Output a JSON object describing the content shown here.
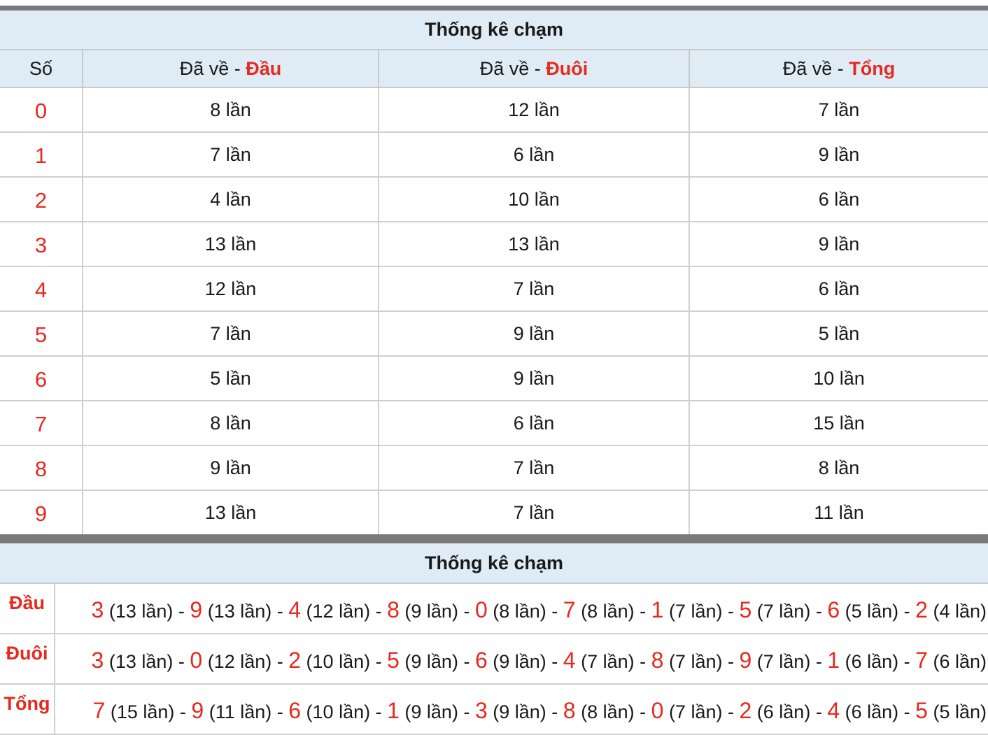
{
  "table1": {
    "title": "Thống kê chạm",
    "col_so": "Số",
    "col_prefix": "Đã về - ",
    "col_dau": "Đầu",
    "col_duoi": "Đuôi",
    "col_tong": "Tổng",
    "rows": [
      {
        "so": "0",
        "dau": "8 lần",
        "duoi": "12 lần",
        "tong": "7 lần"
      },
      {
        "so": "1",
        "dau": "7 lần",
        "duoi": "6 lần",
        "tong": "9 lần"
      },
      {
        "so": "2",
        "dau": "4 lần",
        "duoi": "10 lần",
        "tong": "6 lần"
      },
      {
        "so": "3",
        "dau": "13 lần",
        "duoi": "13 lần",
        "tong": "9 lần"
      },
      {
        "so": "4",
        "dau": "12 lần",
        "duoi": "7 lần",
        "tong": "6 lần"
      },
      {
        "so": "5",
        "dau": "7 lần",
        "duoi": "9 lần",
        "tong": "5 lần"
      },
      {
        "so": "6",
        "dau": "5 lần",
        "duoi": "9 lần",
        "tong": "10 lần"
      },
      {
        "so": "7",
        "dau": "8 lần",
        "duoi": "6 lần",
        "tong": "15 lần"
      },
      {
        "so": "8",
        "dau": "9 lần",
        "duoi": "7 lần",
        "tong": "8 lần"
      },
      {
        "so": "9",
        "dau": "13 lần",
        "duoi": "7 lần",
        "tong": "11 lần"
      }
    ]
  },
  "table2": {
    "title": "Thống kê chạm",
    "rows": [
      {
        "label": "Đầu",
        "items": [
          {
            "digit": "3",
            "count": "(13 lần)"
          },
          {
            "digit": "9",
            "count": "(13 lần)"
          },
          {
            "digit": "4",
            "count": "(12 lần)"
          },
          {
            "digit": "8",
            "count": "(9 lần)"
          },
          {
            "digit": "0",
            "count": "(8 lần)"
          },
          {
            "digit": "7",
            "count": "(8 lần)"
          },
          {
            "digit": "1",
            "count": "(7 lần)"
          },
          {
            "digit": "5",
            "count": "(7 lần)"
          },
          {
            "digit": "6",
            "count": "(5 lần)"
          },
          {
            "digit": "2",
            "count": "(4 lần)"
          }
        ]
      },
      {
        "label": "Đuôi",
        "items": [
          {
            "digit": "3",
            "count": "(13 lần)"
          },
          {
            "digit": "0",
            "count": "(12 lần)"
          },
          {
            "digit": "2",
            "count": "(10 lần)"
          },
          {
            "digit": "5",
            "count": "(9 lần)"
          },
          {
            "digit": "6",
            "count": "(9 lần)"
          },
          {
            "digit": "4",
            "count": "(7 lần)"
          },
          {
            "digit": "8",
            "count": "(7 lần)"
          },
          {
            "digit": "9",
            "count": "(7 lần)"
          },
          {
            "digit": "1",
            "count": "(6 lần)"
          },
          {
            "digit": "7",
            "count": "(6 lần)"
          }
        ]
      },
      {
        "label": "Tổng",
        "items": [
          {
            "digit": "7",
            "count": "(15 lần)"
          },
          {
            "digit": "9",
            "count": "(11 lần)"
          },
          {
            "digit": "6",
            "count": "(10 lần)"
          },
          {
            "digit": "1",
            "count": "(9 lần)"
          },
          {
            "digit": "3",
            "count": "(9 lần)"
          },
          {
            "digit": "8",
            "count": "(8 lần)"
          },
          {
            "digit": "0",
            "count": "(7 lần)"
          },
          {
            "digit": "2",
            "count": "(6 lần)"
          },
          {
            "digit": "4",
            "count": "(6 lần)"
          },
          {
            "digit": "5",
            "count": "(5 lần)"
          }
        ]
      }
    ]
  },
  "colors": {
    "accent_red": "#e8291f",
    "header_bg": "#dfecf6",
    "border_dark": "#7a7a7a",
    "grid_line": "#cfcfcf"
  }
}
